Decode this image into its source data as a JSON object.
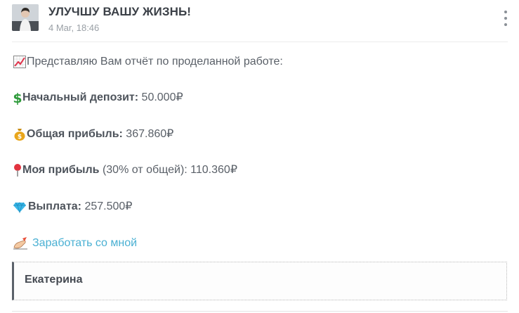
{
  "header": {
    "title": "УЛУЧШУ ВАШУ ЖИЗНЬ!",
    "date": "4 Mar, 18:46",
    "menu_icon": "more-vertical-icon"
  },
  "post": {
    "intro": {
      "icon": "chart-increasing-icon",
      "text": "Представляю Вам отчёт по проделанной работе:"
    },
    "deposit": {
      "icon": "dollar-sign-icon",
      "label": "Начальный депозит:",
      "value": " 50.000₽"
    },
    "total_profit": {
      "icon": "money-bag-icon",
      "label": "Общая прибыль:",
      "value": " 367.860₽"
    },
    "my_profit": {
      "icon": "round-pushpin-icon",
      "label": "Моя прибыль",
      "value": " (30% от общей): 110.360₽"
    },
    "payout": {
      "icon": "gem-icon",
      "label": "Выплата:",
      "value": " 257.500₽"
    },
    "cta": {
      "icon": "writing-hand-icon",
      "link_text": "Заработать со мной"
    }
  },
  "quote": {
    "author": "Екатерина"
  },
  "colors": {
    "link": "#4ab0d3",
    "text": "#5a6068",
    "quote_border": "#5b626a"
  }
}
